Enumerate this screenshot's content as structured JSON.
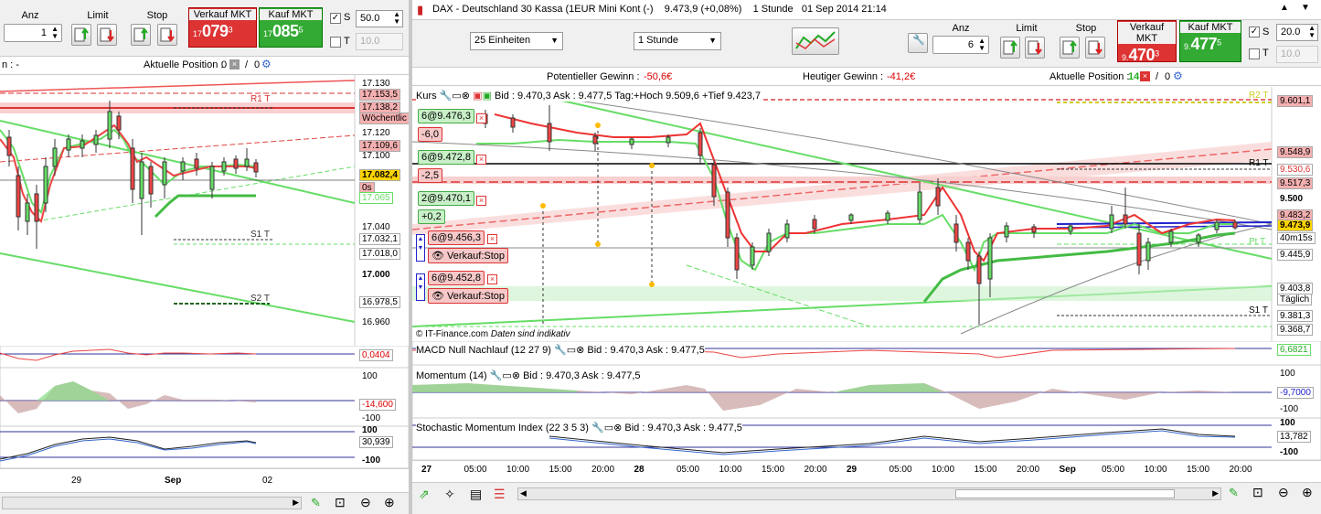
{
  "left": {
    "toolbar": {
      "anz_label": "Anz",
      "limit_label": "Limit",
      "stop_label": "Stop",
      "sell_label": "Verkauf MKT",
      "buy_label": "Kauf MKT",
      "anz_value": "1",
      "sell_price_small": "17",
      "sell_price_big": "079",
      "sell_price_sup": "3",
      "buy_price_small": "17",
      "buy_price_big": "085",
      "buy_price_sup": "5",
      "s_label": "S",
      "s_value": "50.0",
      "t_label": "T",
      "t_value": "10.0"
    },
    "info": {
      "left_text": "n : -",
      "position_label": "Aktuelle Position :",
      "position_value": "0",
      "position_value2": "0"
    },
    "price_axis": [
      "17.130",
      "17.120",
      "17.100",
      "17.040",
      "17.000",
      "16.960"
    ],
    "price_tags": [
      {
        "value": "17.153,5",
        "color": "#f4b0b0"
      },
      {
        "value": "17.138,2",
        "color": "#f4b0b0"
      },
      {
        "value": "Wöchentlic",
        "color": "#fff"
      },
      {
        "value": "17.109,6",
        "color": "#f4b0b0"
      },
      {
        "value": "17.082,4",
        "color": "#ffd400"
      },
      {
        "value": "0s",
        "color": "#f4b0b0"
      },
      {
        "value": "17.065",
        "color": "#fff"
      },
      {
        "value": "17.032,1",
        "color": "#fff"
      },
      {
        "value": "17.018,0",
        "color": "#fff"
      },
      {
        "value": "16.978,5",
        "color": "#fff"
      }
    ],
    "levels": {
      "r1": "R1 T",
      "s1": "S1 T",
      "s2": "S2 T"
    },
    "macd_value": "0,0404",
    "mom_axis": [
      "100",
      "-100"
    ],
    "mom_value": "-14,600",
    "sto_axis": [
      "100",
      "-100"
    ],
    "sto_value": "30,939",
    "x_labels": [
      "29",
      "Sep",
      "02"
    ]
  },
  "right": {
    "title": "DAX - Deutschland 30 Kassa (1EUR Mini Kont (-)    9.473,9 (+0,08%)    1 Stunde   01 Sep 2014 21:14",
    "units_select": "25 Einheiten",
    "interval_select": "1 Stunde",
    "toolbar": {
      "anz_label": "Anz",
      "limit_label": "Limit",
      "stop_label": "Stop",
      "sell_label": "Verkauf MKT",
      "buy_label": "Kauf MKT",
      "anz_value": "6",
      "sell_price_small": "9.",
      "sell_price_big": "470",
      "sell_price_sup": "3",
      "buy_price_small": "9.",
      "buy_price_big": "477",
      "buy_price_sup": "5",
      "s_label": "S",
      "s_value": "20.0",
      "t_label": "T",
      "t_value": "10.0"
    },
    "info": {
      "potential_label": "Potentieller Gewinn :",
      "potential_value": "-50,6€",
      "today_label": "Heutiger Gewinn :",
      "today_value": "-41,2€",
      "position_label": "Aktuelle Position :",
      "position_value": "14",
      "position_value2": "0"
    },
    "main_header": "Kurs",
    "bid_ask": "Bid : 9.470,3 Ask : 9.477,5 Tag:+Hoch 9.509,6 +Tief 9.423,7",
    "positions": [
      {
        "label": "6@9.476,3",
        "pnl": "-6,0"
      },
      {
        "label": "6@9.472,8",
        "pnl": "-2,5"
      },
      {
        "label": "2@9.470,1",
        "pnl": "+0,2"
      }
    ],
    "stops": [
      {
        "label": "6@9.456,3",
        "action": "Verkauf:Stop"
      },
      {
        "label": "6@9.452,8",
        "action": "Verkauf:Stop"
      }
    ],
    "copyright": "© IT-Finance.com",
    "disclaimer": "Daten sind indikativ",
    "levels": {
      "r2": "R2 T",
      "r1": "R1 T",
      "p": "Pt T",
      "s1": "S1 T"
    },
    "price_tags": [
      {
        "value": "9.601,1",
        "color": "#f4b0b0"
      },
      {
        "value": "9.548,9",
        "color": "#f4b0b0"
      },
      {
        "value": "9.530,6",
        "color": "#fff"
      },
      {
        "value": "9.517,3",
        "color": "#f4b0b0"
      },
      {
        "value": "9.500",
        "color": "#fff"
      },
      {
        "value": "9.483,2",
        "color": "#f4b0b0"
      },
      {
        "value": "9.473,9",
        "color": "#ffd400"
      },
      {
        "value": "40m15s",
        "color": "#fff"
      },
      {
        "value": "9.445,9",
        "color": "#fff"
      },
      {
        "value": "9.403,8",
        "color": "#fff"
      },
      {
        "value": "Täglich",
        "color": "#fff"
      },
      {
        "value": "9.381,3",
        "color": "#fff"
      },
      {
        "value": "9.368,7",
        "color": "#fff"
      }
    ],
    "macd_header": "MACD Null Nachlauf (12 27 9)",
    "macd_bid": "Bid : 9.470,3 Ask : 9.477,5",
    "macd_value": "6,6821",
    "mom_header": "Momentum (14)",
    "mom_bid": "Bid : 9.470,3 Ask : 9.477,5",
    "mom_axis": [
      "100",
      "-100"
    ],
    "mom_value": "-9,7000",
    "sto_header": "Stochastic Momentum Index (22 3 5 3)",
    "sto_bid": "Bid : 9.470,3 Ask : 9.477,5",
    "sto_axis": [
      "100",
      "-100"
    ],
    "sto_value": "13,782",
    "x_labels": [
      "27",
      "05:00",
      "10:00",
      "15:00",
      "20:00",
      "28",
      "05:00",
      "10:00",
      "15:00",
      "20:00",
      "29",
      "05:00",
      "10:00",
      "15:00",
      "20:00",
      "Sep",
      "05:00",
      "10:00",
      "15:00",
      "20:00"
    ]
  }
}
